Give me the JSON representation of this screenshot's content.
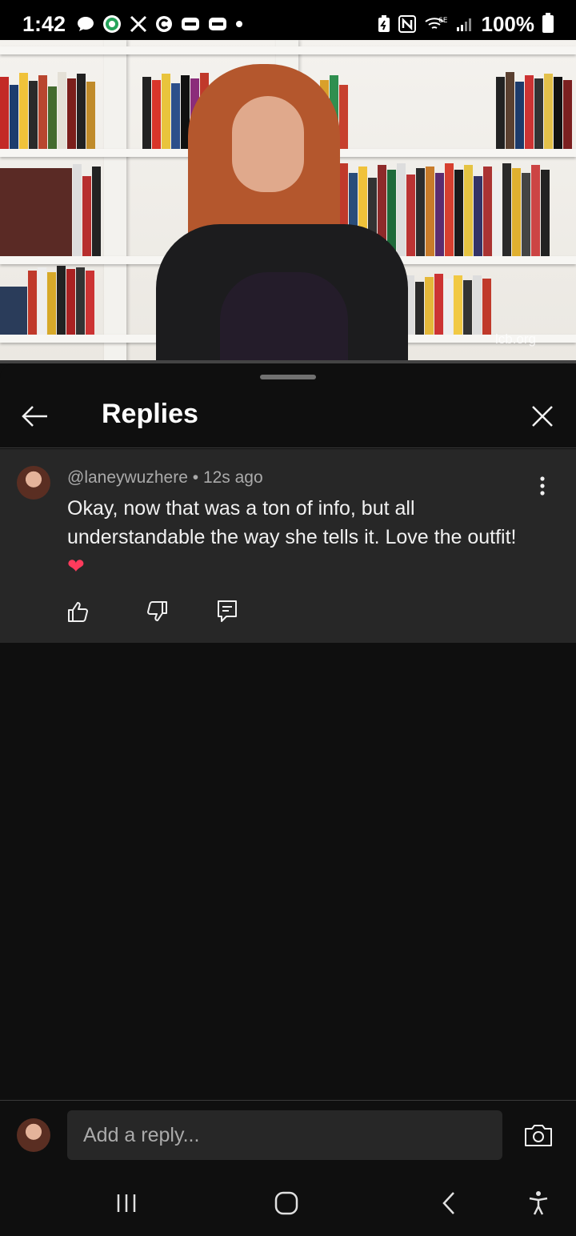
{
  "status_bar": {
    "time": "1:42",
    "battery": "100%",
    "signal": "6E",
    "icons_left": [
      "chat-bubble-icon",
      "whatsapp-icon",
      "x-icon",
      "c-icon",
      "wallet-icon",
      "wallet-icon",
      "dot-icon"
    ],
    "icons_right": [
      "battery-saver-icon",
      "nfc-icon",
      "wifi-icon",
      "signal-icon"
    ]
  },
  "video": {
    "watermark": "lcb.org",
    "progress_fraction": 0.0
  },
  "panel": {
    "title": "Replies"
  },
  "comment": {
    "author": "@laneywuzhere",
    "separator": " • ",
    "time": "12s ago",
    "text": "Okay,  now that was a ton of info,  but all understandable the way she tells it.  Love the outfit!",
    "emoji": "❤"
  },
  "reply": {
    "placeholder": "Add a reply..."
  },
  "colors": {
    "background": "#0f0f0f",
    "comment_bg": "#272727",
    "meta_text": "#aaaaaa",
    "heart": "#ff3b5c",
    "progress": "#ff0000"
  }
}
